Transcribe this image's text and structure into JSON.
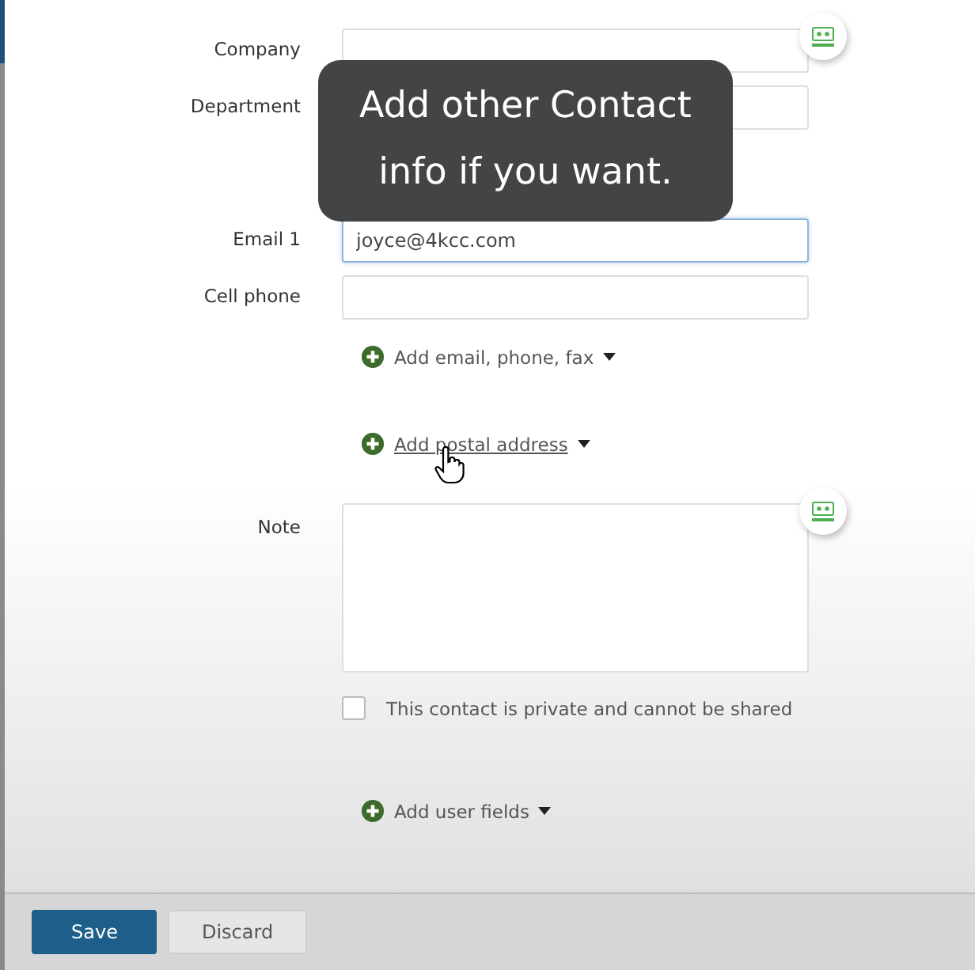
{
  "overlay": {
    "text": "Add other Contact info if you want."
  },
  "form": [
    {
      "kind": "field",
      "label": "Company",
      "card_button": true,
      "focused": false
    },
    {
      "kind": "field",
      "label": "Department",
      "card_button": false,
      "focused": false
    },
    {
      "kind": "gap"
    },
    {
      "kind": "field",
      "label": "Email 1",
      "value": "joyce@4kcc.com",
      "focused": true,
      "card_button": false
    },
    {
      "kind": "field",
      "label": "Cell phone",
      "focused": false,
      "card_button": false
    },
    {
      "kind": "link",
      "text": "Add email, phone, fax",
      "hovered": false
    },
    {
      "kind": "link",
      "text": "Add postal address",
      "hovered": true
    },
    {
      "kind": "textarea",
      "label": "Note",
      "card_button": true
    },
    {
      "kind": "checkbox",
      "text": "This contact is private and cannot be shared",
      "checked": false
    },
    {
      "kind": "link",
      "text": "Add user fields",
      "hovered": false
    }
  ],
  "footer": {
    "buttons": [
      {
        "label": "Save",
        "primary": true
      },
      {
        "label": "Discard",
        "primary": false
      }
    ]
  }
}
